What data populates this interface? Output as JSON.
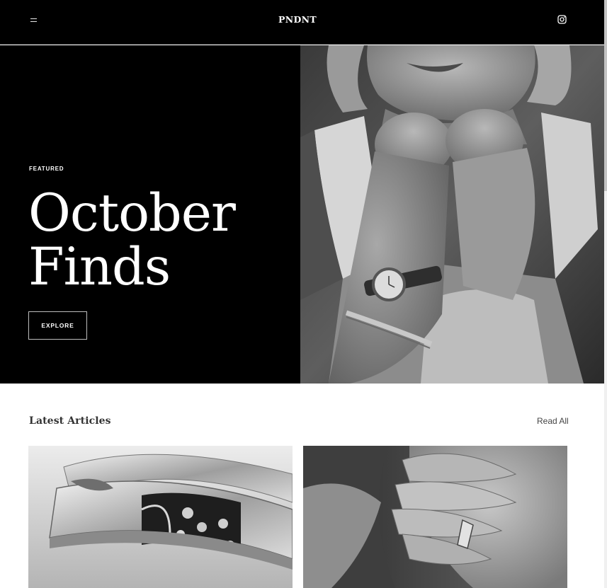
{
  "header": {
    "logo": "PNDNT",
    "menu_icon": "menu-icon",
    "social_icon": "instagram-icon"
  },
  "hero": {
    "eyebrow": "FEATURED",
    "title_line1": "October",
    "title_line2": "Finds",
    "cta_label": "EXPLORE",
    "image": "woman-wearing-watch-and-bangle-photo"
  },
  "articles": {
    "heading": "Latest Articles",
    "read_all_label": "Read All",
    "cards": [
      {
        "image": "ornate-floral-silver-bracelet-photo"
      },
      {
        "image": "hand-wearing-ring-photo"
      }
    ]
  },
  "colors": {
    "background": "#ffffff",
    "header_bg": "#000000",
    "text_light": "#ffffff",
    "button_border": "#bdbdbd"
  }
}
